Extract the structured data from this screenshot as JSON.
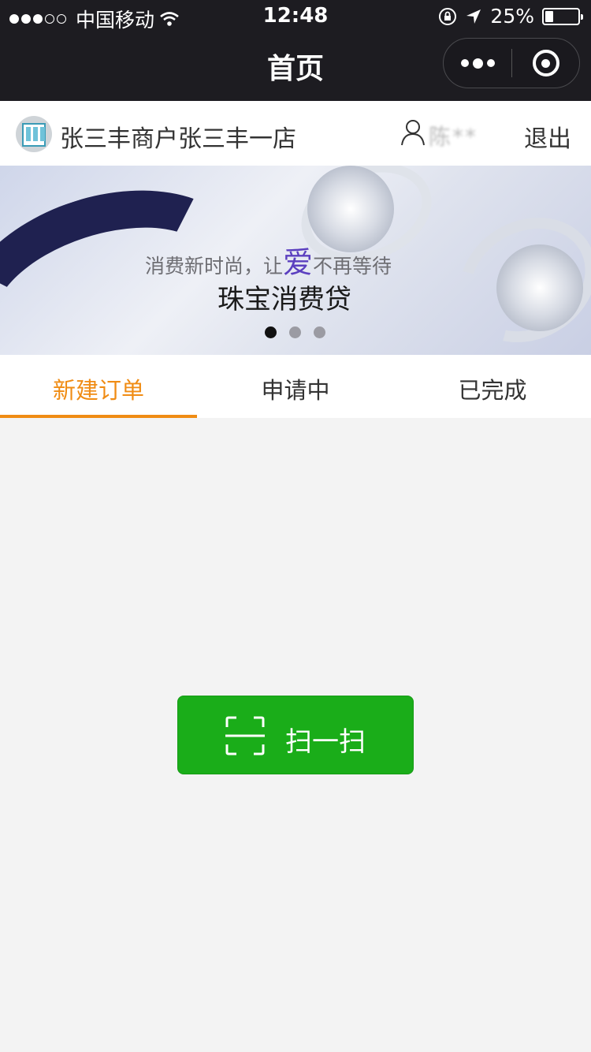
{
  "status_bar": {
    "carrier": "中国移动",
    "time": "12:48",
    "battery": "25%",
    "battery_level": 0.25
  },
  "nav": {
    "title": "首页",
    "more_icon": "ellipsis-icon",
    "close_icon": "target-icon"
  },
  "merchant": {
    "name": "张三丰商户张三丰一店",
    "user_name": "陈**",
    "logout_label": "退出"
  },
  "banner": {
    "tagline_before": "消费新时尚，让",
    "tagline_love": "爱",
    "tagline_after": "不再等待",
    "headline": "珠宝消费贷",
    "slides": 3,
    "active_slide": 1
  },
  "tabs": [
    {
      "label": "新建订单",
      "active": true
    },
    {
      "label": "申请中",
      "active": false
    },
    {
      "label": "已完成",
      "active": false
    }
  ],
  "scan_button": {
    "label": "扫一扫",
    "icon": "scan-frame-icon"
  },
  "colors": {
    "accent": "#f08c14",
    "button_green": "#1aad19",
    "navbar": "#1d1c21",
    "page_bg": "#f3f3f3"
  }
}
